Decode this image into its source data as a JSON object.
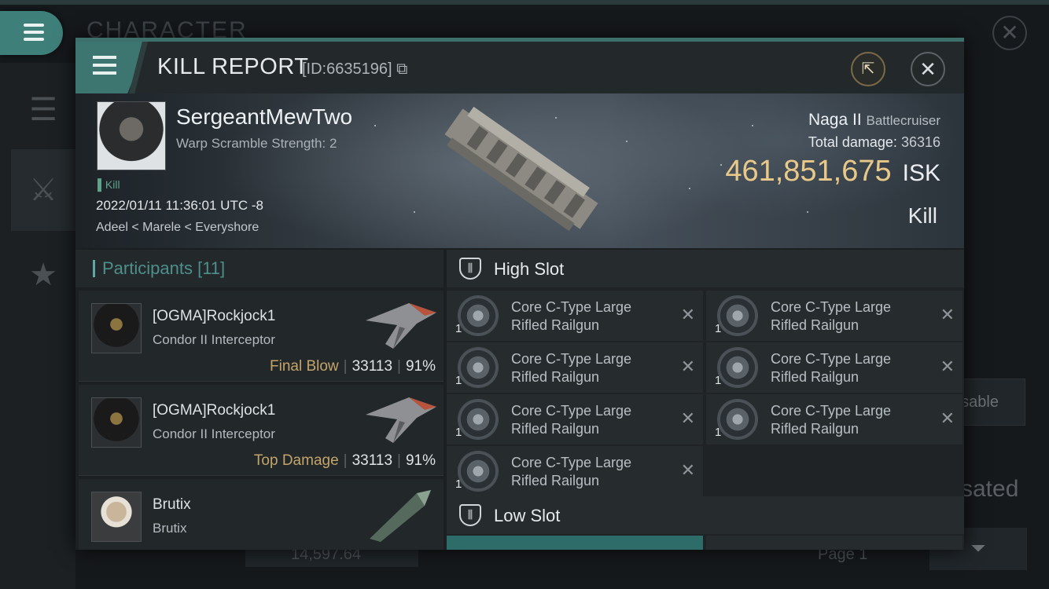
{
  "background": {
    "title": "CHARACTER",
    "close_icon": "close-icon",
    "right_pill_text": "nsable",
    "right_large_text": "sated",
    "balance": "14,597.64",
    "page_label": "Page 1"
  },
  "header": {
    "title": "KILL REPORT",
    "id_label": "[ID:6635196]",
    "share_icon": "external-link-icon",
    "close_icon": "close-icon"
  },
  "victim": {
    "name": "SergeantMewTwo",
    "subtitle": "Warp Scramble Strength: 2",
    "tag": "Kill",
    "datetime": "2022/01/11 11:36:01 UTC -8",
    "location": "Adeel < Marele < Everyshore"
  },
  "ship": {
    "name": "Naga II",
    "class": "Battlecruiser",
    "damage_label": "Total damage:",
    "damage_value": "36316",
    "isk_value": "461,851,675",
    "isk_unit": "ISK",
    "result": "Kill"
  },
  "participants": {
    "header": "Participants",
    "count": "[11]",
    "rows": [
      {
        "name": "[OGMA]Rockjock1",
        "ship": "Condor II Interceptor",
        "role": "Final Blow",
        "damage": "33113",
        "percent": "91%"
      },
      {
        "name": "[OGMA]Rockjock1",
        "ship": "Condor II Interceptor",
        "role": "Top Damage",
        "damage": "33113",
        "percent": "91%"
      },
      {
        "name": "Brutix",
        "ship": "Brutix",
        "role": "",
        "damage": "",
        "percent": ""
      }
    ]
  },
  "slots": {
    "high_label": "High Slot",
    "low_label": "Low Slot",
    "high_items": [
      {
        "qty": "1",
        "line1": "Core C-Type Large",
        "line2": "Rifled Railgun"
      },
      {
        "qty": "1",
        "line1": "Core C-Type Large",
        "line2": "Rifled Railgun"
      },
      {
        "qty": "1",
        "line1": "Core C-Type Large",
        "line2": "Rifled Railgun"
      },
      {
        "qty": "1",
        "line1": "Core C-Type Large",
        "line2": "Rifled Railgun"
      },
      {
        "qty": "1",
        "line1": "Core C-Type Large",
        "line2": "Rifled Railgun"
      },
      {
        "qty": "1",
        "line1": "Core C-Type Large",
        "line2": "Rifled Railgun"
      },
      {
        "qty": "1",
        "line1": "Core C-Type Large",
        "line2": "Rifled Railgun"
      }
    ]
  },
  "colors": {
    "accent_teal": "#3d7671",
    "isk_gold": "#e9c98a",
    "role_gold": "#c4a46a"
  }
}
